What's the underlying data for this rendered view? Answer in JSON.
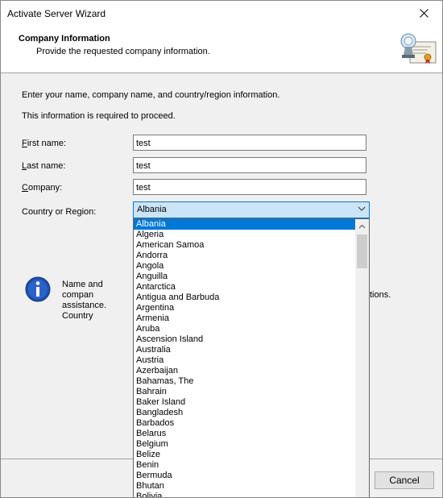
{
  "window": {
    "title": "Activate Server Wizard"
  },
  "header": {
    "title": "Company Information",
    "subtitle": "Provide the requested company information."
  },
  "intro": {
    "line1": "Enter your name, company name, and country/region information.",
    "line2": "This information is required to proceed."
  },
  "form": {
    "first_name": {
      "label_accel": "F",
      "label_rest": "irst name:",
      "value": "test"
    },
    "last_name": {
      "label_accel": "L",
      "label_rest": "ast name:",
      "value": "test"
    },
    "company": {
      "label_accel": "C",
      "label_rest": "ompany:",
      "value": "test"
    },
    "country": {
      "label": "Country or Region:",
      "value": "Albania"
    }
  },
  "info": {
    "text_line1": "Name and compan",
    "text_line2": "assistance. Country",
    "text_right": "tions."
  },
  "footer": {
    "cancel_label": "Cancel"
  },
  "dropdown_options": [
    "Albania",
    "Algeria",
    "American Samoa",
    "Andorra",
    "Angola",
    "Anguilla",
    "Antarctica",
    "Antigua and Barbuda",
    "Argentina",
    "Armenia",
    "Aruba",
    "Ascension Island",
    "Australia",
    "Austria",
    "Azerbaijan",
    "Bahamas, The",
    "Bahrain",
    "Baker Island",
    "Bangladesh",
    "Barbados",
    "Belarus",
    "Belgium",
    "Belize",
    "Benin",
    "Bermuda",
    "Bhutan",
    "Bolivia"
  ],
  "selected_option": "Albania",
  "icons": {
    "close": "close-icon",
    "certificate": "certificate-icon",
    "info": "info-icon",
    "chevron": "chevron-down-icon",
    "scroll_up": "scroll-up-arrow-icon"
  },
  "colors": {
    "accent": "#0078d7",
    "select_bg": "#cce4f7",
    "info_blue": "#1c4fb0"
  }
}
